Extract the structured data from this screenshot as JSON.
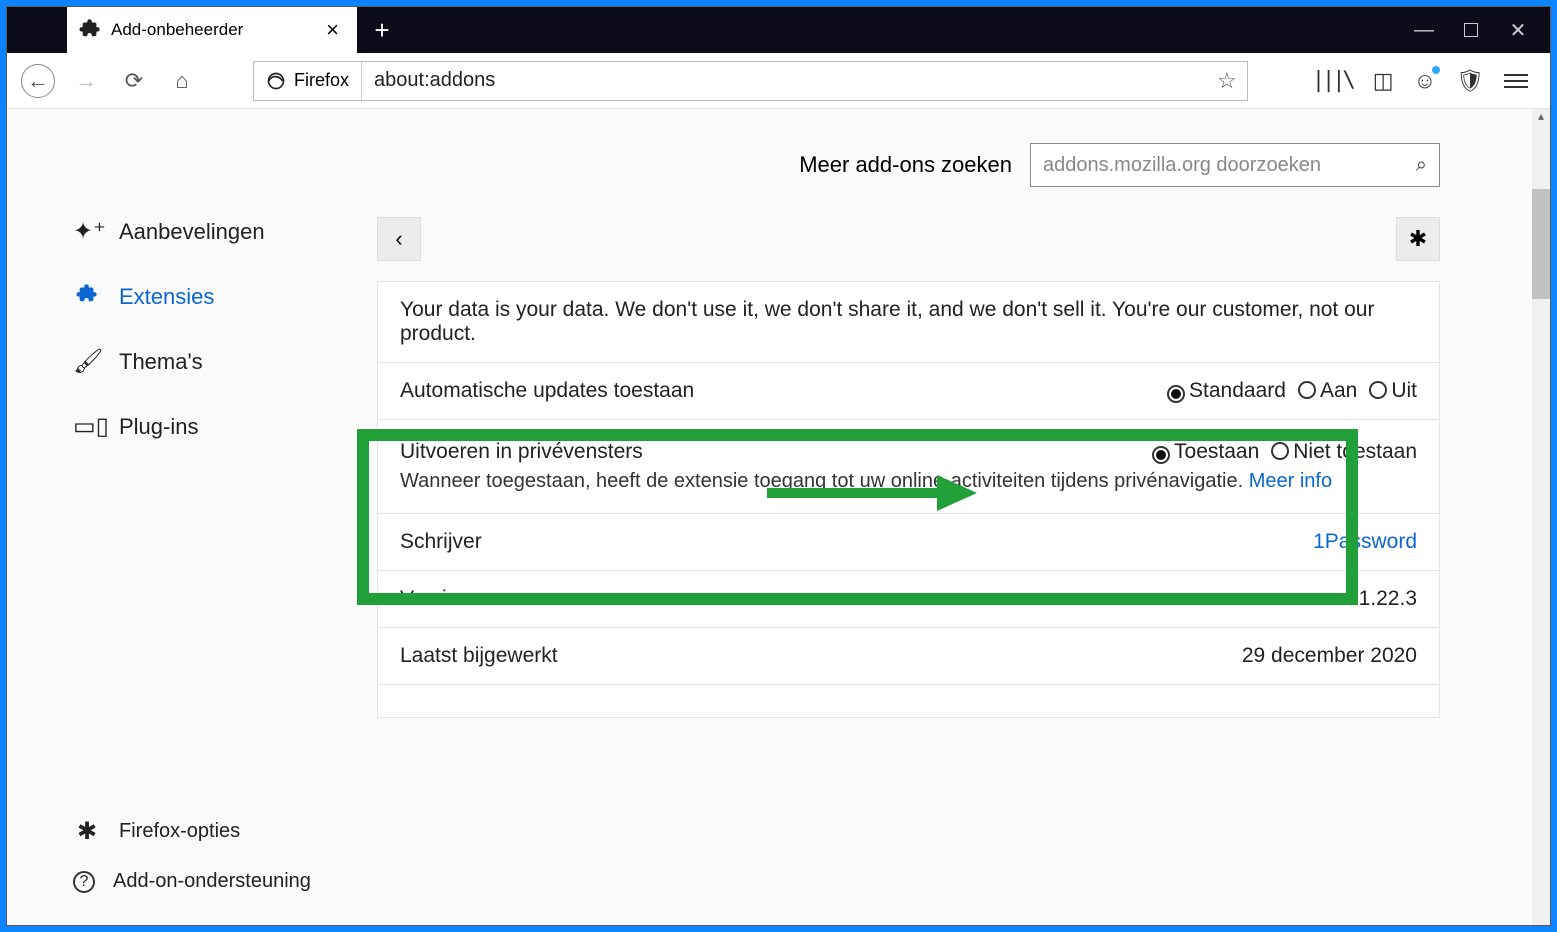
{
  "tab": {
    "title": "Add-onbeheerder"
  },
  "url": {
    "identity": "Firefox",
    "address": "about:addons"
  },
  "search": {
    "label": "Meer add-ons zoeken",
    "placeholder": "addons.mozilla.org doorzoeken"
  },
  "sidebar": {
    "items": [
      {
        "label": "Aanbevelingen"
      },
      {
        "label": "Extensies"
      },
      {
        "label": "Thema's"
      },
      {
        "label": "Plug-ins"
      }
    ],
    "footer": [
      {
        "label": "Firefox-opties"
      },
      {
        "label": "Add-on-ondersteuning"
      }
    ]
  },
  "detail": {
    "blurb": "Your data is your data. We don't use it, we don't share it, and we don't sell it. You're our customer, not our product.",
    "autoupdate": {
      "label": "Automatische updates toestaan",
      "opts": [
        "Standaard",
        "Aan",
        "Uit"
      ],
      "selected": "Standaard"
    },
    "private": {
      "label": "Uitvoeren in privévensters",
      "desc_a": "Wanneer toegestaan, heeft de extensie toegang tot uw online-activiteiten tijdens privénavigatie. ",
      "more": "Meer info",
      "opts": [
        "Toestaan",
        "Niet toestaan"
      ],
      "selected": "Toestaan"
    },
    "author": {
      "label": "Schrijver",
      "value": "1Password"
    },
    "version": {
      "label": "Versie",
      "value": "1.22.3"
    },
    "updated": {
      "label": "Laatst bijgewerkt",
      "value": "29 december 2020"
    }
  }
}
